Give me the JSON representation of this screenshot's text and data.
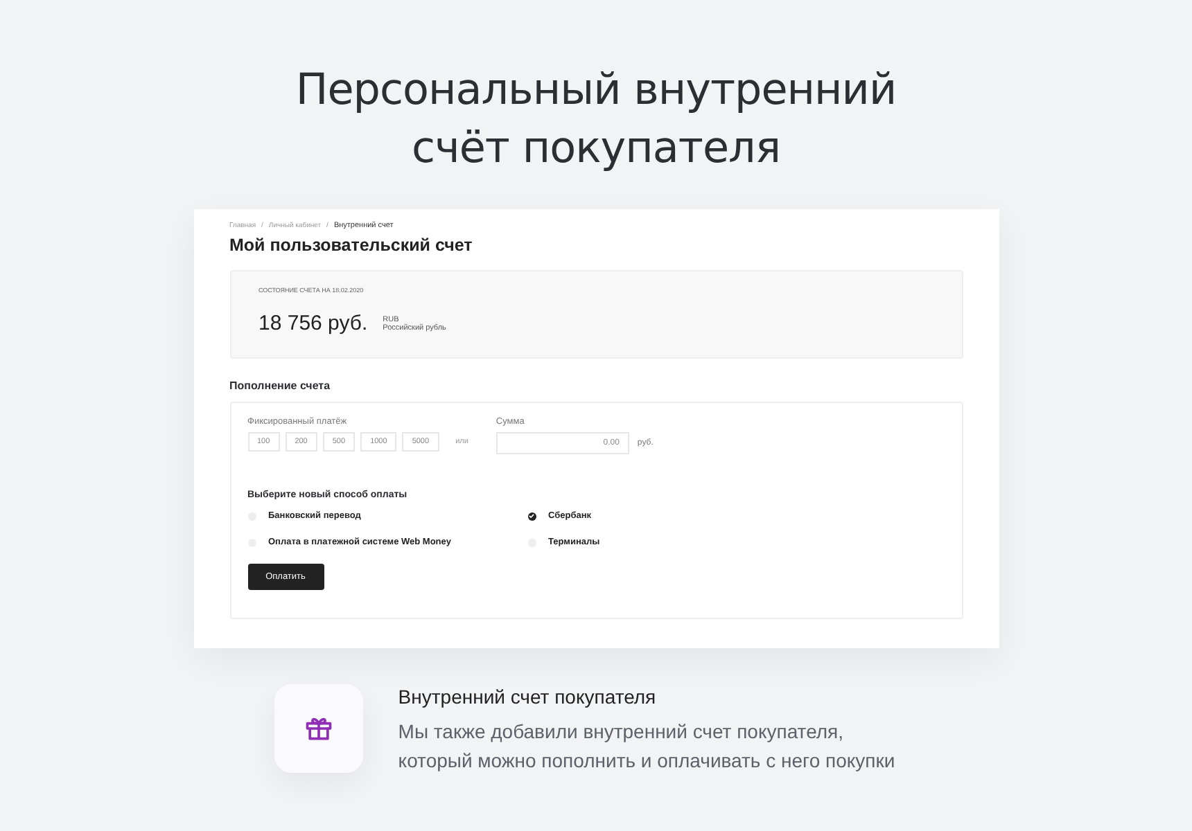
{
  "headline": [
    "Персональный внутренний",
    "счёт покупателя"
  ],
  "screen": {
    "breadcrumbs": [
      {
        "label": "Главная",
        "current": false
      },
      {
        "label": "Личный кабинет",
        "current": false
      },
      {
        "label": "Внутренний счет",
        "current": true
      }
    ],
    "breadcrumb_separator": "/",
    "title": "Мой пользовательский счет",
    "balance": {
      "caption": "СОСТОЯНИЕ СЧЕТА НА 18.02.2020",
      "amount": "18 756 руб.",
      "currency_code": "RUB",
      "currency_name": "Российский рубль"
    },
    "topup": {
      "title": "Пополнение счета",
      "fixed_label": "Фиксированный платёж",
      "fixed_amounts": [
        "100",
        "200",
        "500",
        "1000",
        "5000"
      ],
      "or": "или",
      "sum_label": "Сумма",
      "sum_value": "0.00",
      "sum_unit": "руб.",
      "methods_title": "Выберите новый способ оплаты",
      "methods": [
        {
          "label": "Банковский перевод",
          "selected": false
        },
        {
          "label": "Сбербанк",
          "selected": true
        },
        {
          "label": "Оплата в платежной системе Web Money",
          "selected": false
        },
        {
          "label": "Терминалы",
          "selected": false
        }
      ],
      "pay_button": "Оплатить"
    }
  },
  "feature": {
    "title": "Внутренний счет покупателя",
    "text": [
      "Мы также добавили внутренний счет покупателя,",
      "который можно пополнить и оплачивать с него покупки"
    ]
  }
}
